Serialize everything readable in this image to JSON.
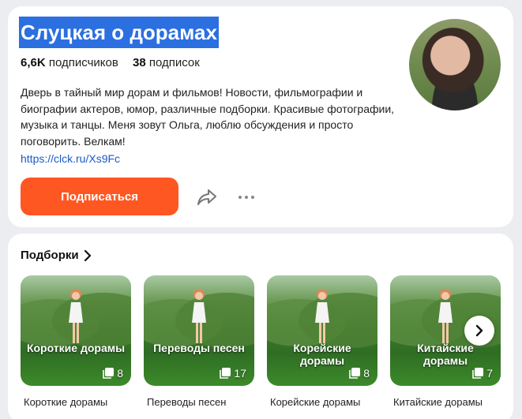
{
  "profile": {
    "title": "Слуцкая о дорамах",
    "subscribers_count": "6,6K",
    "subscribers_label": "подписчиков",
    "subscriptions_count": "38",
    "subscriptions_label": "подписок",
    "description": "Дверь в тайный мир дорам и фильмов! Новости, фильмографии и биографии актеров, юмор, различные подборки. Красивые фотографии, музыка и танцы. Меня зовут Ольга, люблю обсуждения и просто поговорить. Велкам!",
    "link": "https://clck.ru/Xs9Fc",
    "subscribe_label": "Подписаться",
    "accent_color": "#ff5722",
    "title_highlight_color": "#2b6fe0"
  },
  "collections": {
    "title": "Подборки",
    "items": [
      {
        "overlay": "Короткие дорамы",
        "count": "8",
        "caption": "Короткие дорамы"
      },
      {
        "overlay": "Переводы песен",
        "count": "17",
        "caption": "Переводы песен"
      },
      {
        "overlay": "Корейские дорамы",
        "count": "8",
        "caption": "Корейские дорамы"
      },
      {
        "overlay": "Китайские дорамы",
        "count": "7",
        "caption": "Китайские дорамы"
      }
    ]
  },
  "icons": {
    "share": "share-icon",
    "more": "more-icon",
    "chevron": "chevron-right-icon",
    "next": "chevron-right-icon",
    "count": "stack-icon"
  }
}
